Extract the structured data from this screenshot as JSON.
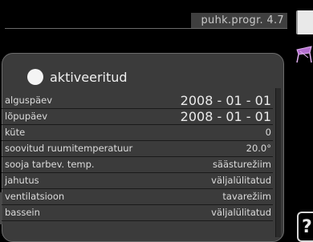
{
  "header": {
    "title": "puhk.progr. 4.7"
  },
  "panel": {
    "status": {
      "label": "aktiveeritud"
    },
    "rows": [
      {
        "label": "alguspäev",
        "value": "2008 - 01 - 01"
      },
      {
        "label": "lõpupäev",
        "value": "2008 - 01 - 01"
      },
      {
        "label": "küte",
        "value": "0"
      },
      {
        "label": "soovitud ruumitemperatuur",
        "value": "20.0°"
      },
      {
        "label": "sooja tarbev. temp.",
        "value": "säästurežiim"
      },
      {
        "label": "jahutus",
        "value": "väljalülitatud"
      },
      {
        "label": "ventilatsioon",
        "value": "tavarežiim"
      },
      {
        "label": "bassein",
        "value": "väljalülitatud"
      }
    ]
  },
  "icons": {
    "top_right": "book-icon",
    "mid_right": "lounge-chair-icon",
    "help": "help-icon",
    "help_glyph": "?"
  }
}
